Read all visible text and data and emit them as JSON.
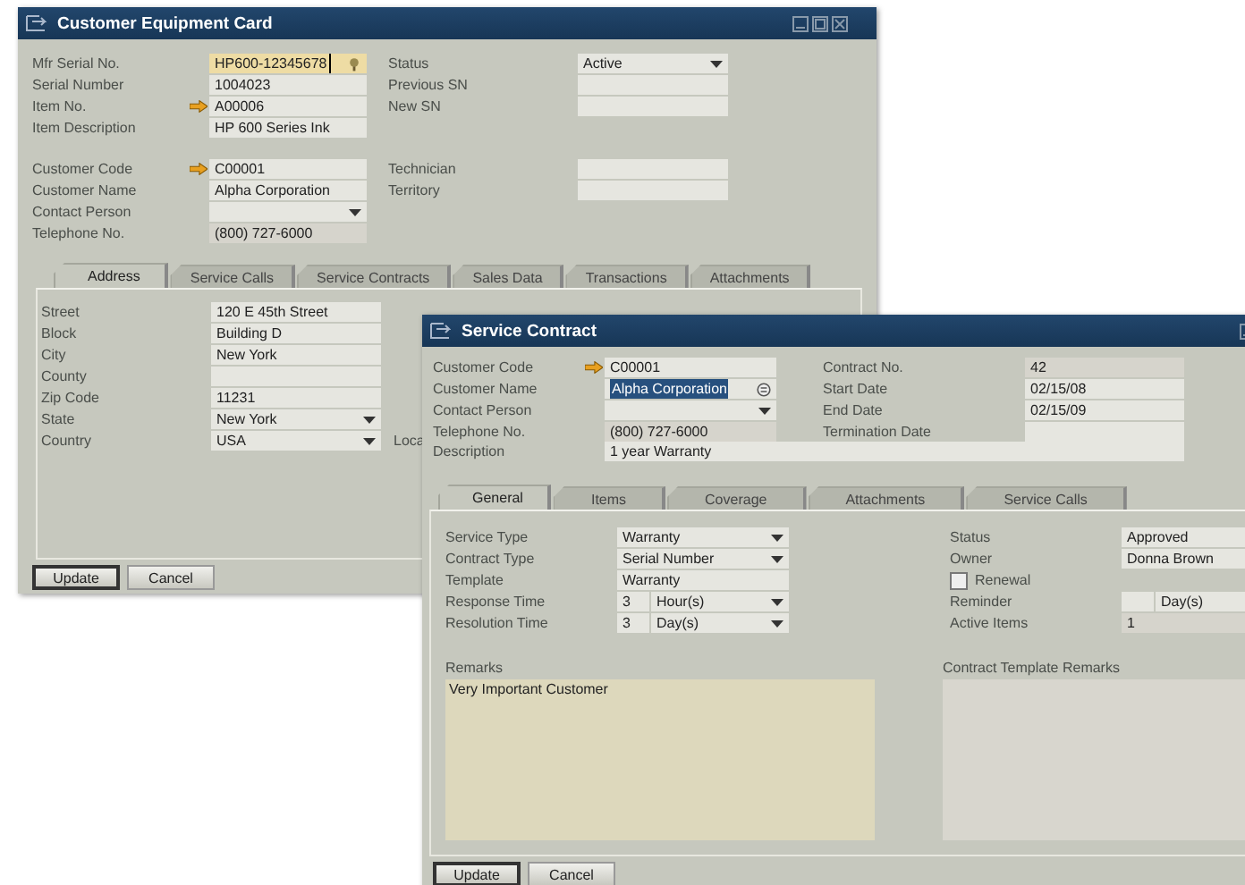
{
  "back_window": {
    "title": "Customer Equipment Card",
    "equipment": {
      "left": [
        {
          "label": "Mfr Serial No.",
          "value": "HP600-12345678",
          "kind": "focused"
        },
        {
          "label": "Serial Number",
          "value": "1004023",
          "kind": "text"
        },
        {
          "label": "Item No.",
          "value": "A00006",
          "kind": "link"
        },
        {
          "label": "Item Description",
          "value": "HP 600 Series Ink",
          "kind": "text"
        }
      ],
      "right": [
        {
          "label": "Status",
          "value": "Active",
          "kind": "dropdown"
        },
        {
          "label": "Previous SN",
          "kind": "text"
        },
        {
          "label": "New SN",
          "kind": "text"
        }
      ]
    },
    "customer": {
      "left": [
        {
          "label": "Customer Code",
          "value": "C00001",
          "kind": "link"
        },
        {
          "label": "Customer Name",
          "value": "Alpha Corporation",
          "kind": "text"
        },
        {
          "label": "Contact Person",
          "kind": "dropdown"
        },
        {
          "label": "Telephone No.",
          "value": "(800) 727-6000",
          "kind": "readonly"
        }
      ],
      "right": [
        {
          "label": "Technician",
          "kind": "text"
        },
        {
          "label": "Territory",
          "kind": "text"
        }
      ]
    },
    "tabs": [
      {
        "label": "Address",
        "selected": true
      },
      {
        "label": "Service Calls",
        "selected": false
      },
      {
        "label": "Service Contracts",
        "selected": false
      },
      {
        "label": "Sales Data",
        "selected": false
      },
      {
        "label": "Transactions",
        "selected": false
      },
      {
        "label": "Attachments",
        "selected": false
      }
    ],
    "address": [
      {
        "label": "Street",
        "value": "120 E 45th Street",
        "kind": "text"
      },
      {
        "label": "Block",
        "value": "Building D",
        "kind": "text"
      },
      {
        "label": "City",
        "value": "New York",
        "kind": "text"
      },
      {
        "label": "County",
        "kind": "text"
      },
      {
        "label": "Zip Code",
        "value": "11231",
        "kind": "text"
      },
      {
        "label": "State",
        "value": "New York",
        "kind": "dropdown"
      },
      {
        "label": "Country",
        "value": "USA",
        "kind": "dropdown"
      }
    ],
    "side_label": "Loca",
    "buttons": [
      {
        "label": "Update",
        "default": true
      },
      {
        "label": "Cancel",
        "default": false
      }
    ]
  },
  "front_window": {
    "title": "Service Contract",
    "header": {
      "left": [
        {
          "label": "Customer Code",
          "value": "C00001",
          "kind": "link"
        },
        {
          "label": "Customer Name",
          "value": "Alpha Corporation",
          "kind": "highlighted"
        },
        {
          "label": "Contact Person",
          "kind": "dropdown"
        },
        {
          "label": "Telephone No.",
          "value": "(800) 727-6000",
          "kind": "readonly"
        }
      ],
      "right": [
        {
          "label": "Contract No.",
          "value": "42",
          "kind": "readonly"
        },
        {
          "label": "Start Date",
          "value": "02/15/08",
          "kind": "text"
        },
        {
          "label": "End Date",
          "value": "02/15/09",
          "kind": "text"
        },
        {
          "label": "Termination Date",
          "kind": "text"
        }
      ]
    },
    "description": {
      "label": "Description",
      "value": "1 year Warranty",
      "kind": "text"
    },
    "tabs": [
      {
        "label": "General",
        "selected": true
      },
      {
        "label": "Items",
        "selected": false
      },
      {
        "label": "Coverage",
        "selected": false
      },
      {
        "label": "Attachments",
        "selected": false
      },
      {
        "label": "Service Calls",
        "selected": false
      }
    ],
    "general": {
      "left": [
        {
          "label": "Service Type",
          "value": "Warranty",
          "kind": "dropdown"
        },
        {
          "label": "Contract Type",
          "value": "Serial Number",
          "kind": "dropdown"
        },
        {
          "label": "Template",
          "value": "Warranty",
          "kind": "text"
        },
        {
          "label": "Response Time",
          "value": "3",
          "unit": "Hour(s)",
          "kind": "split",
          "dropdown": true
        },
        {
          "label": "Resolution Time",
          "value": "3",
          "unit": "Day(s)",
          "kind": "split",
          "dropdown": true
        }
      ],
      "right": [
        {
          "label": "Status",
          "value": "Approved",
          "kind": "text"
        },
        {
          "label": "Owner",
          "value": "Donna Brown",
          "kind": "text"
        },
        {
          "label": "Renewal",
          "kind": "checkbox",
          "checked": false
        },
        {
          "label": "Reminder",
          "unit": "Day(s)",
          "kind": "split"
        },
        {
          "label": "Active Items",
          "value": "1",
          "kind": "readonly"
        }
      ]
    },
    "remarks": {
      "label": "Remarks",
      "value": "Very Important Customer"
    },
    "template_remarks": {
      "label": "Contract Template Remarks"
    },
    "buttons": [
      {
        "label": "Update",
        "default": true
      },
      {
        "label": "Cancel",
        "default": false
      }
    ]
  }
}
